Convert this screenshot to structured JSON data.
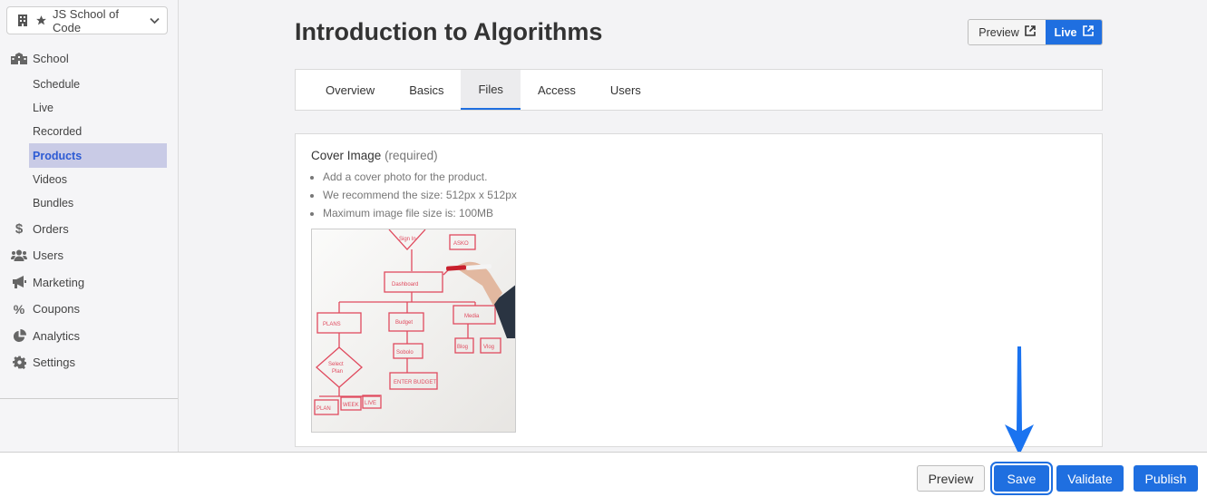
{
  "sidebar": {
    "school_name": "JS School of Code",
    "nav": [
      {
        "label": "School",
        "icon": "school-icon"
      },
      {
        "label": "Orders",
        "icon": "dollar-icon"
      },
      {
        "label": "Users",
        "icon": "users-icon"
      },
      {
        "label": "Marketing",
        "icon": "megaphone-icon"
      },
      {
        "label": "Coupons",
        "icon": "percent-icon"
      },
      {
        "label": "Analytics",
        "icon": "pie-chart-icon"
      },
      {
        "label": "Settings",
        "icon": "gear-icon"
      }
    ],
    "school_sub": [
      "Schedule",
      "Live",
      "Recorded",
      "Products",
      "Videos",
      "Bundles"
    ],
    "active_sub": "Products"
  },
  "page": {
    "title": "Introduction to Algorithms",
    "preview_label": "Preview",
    "live_label": "Live"
  },
  "tabs": [
    "Overview",
    "Basics",
    "Files",
    "Access",
    "Users"
  ],
  "active_tab": "Files",
  "cover": {
    "label": "Cover Image",
    "required": "(required)",
    "hints": [
      "Add a cover photo for the product.",
      "We recommend the size: 512px x 512px",
      "Maximum image file size is: 100MB"
    ]
  },
  "footer": {
    "preview": "Preview",
    "save": "Save",
    "validate": "Validate",
    "publish": "Publish"
  },
  "colors": {
    "accent": "#1f6fe0",
    "active_sub_bg": "#c9cbe6",
    "arrow": "#1a73f0"
  }
}
